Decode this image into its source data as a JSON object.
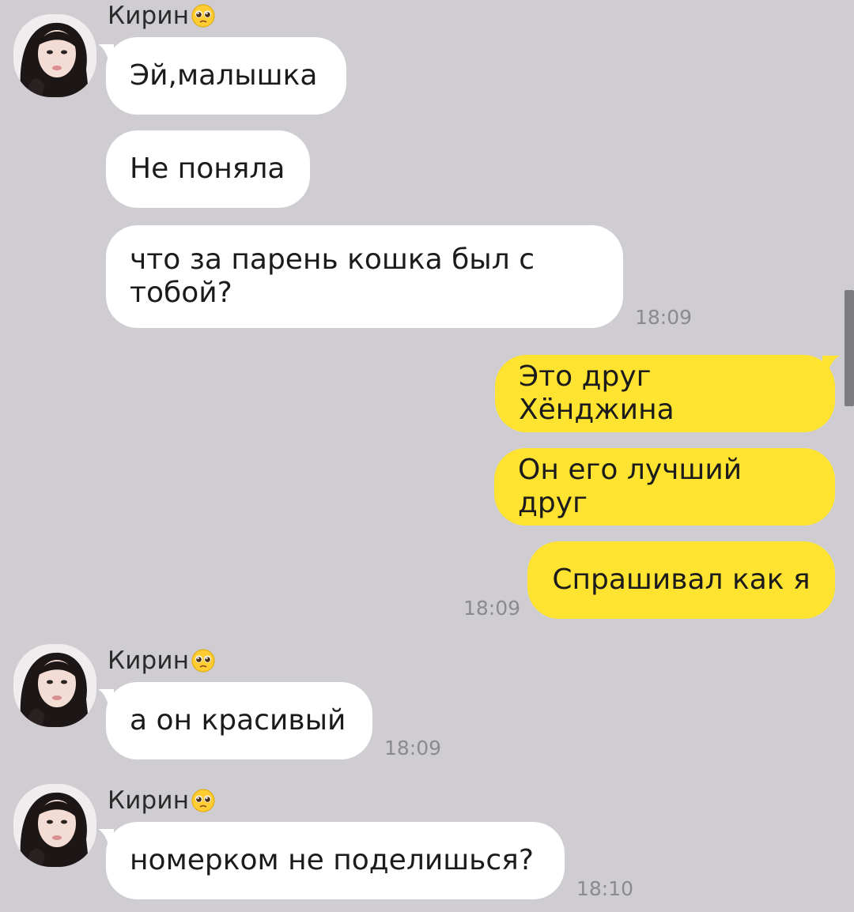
{
  "chat": {
    "contact_name": "Кирин",
    "contact_emoji": "pleading-face-emoji",
    "groups": [
      {
        "messages": [
          "Эй,малышка",
          "Не поняла",
          "что за парень кошка был с тобой?"
        ],
        "time": "18:09"
      },
      {
        "messages": [
          "Это друг Хёнджина",
          "Он его лучший друг",
          "Спрашивал как я"
        ],
        "time": "18:09"
      },
      {
        "messages": [
          "а он красивый"
        ],
        "time": "18:09"
      },
      {
        "messages": [
          "номерком не поделишься?"
        ],
        "time": "18:10"
      }
    ]
  },
  "colors": {
    "background": "#cfcdd1",
    "incoming_bubble": "#ffffff",
    "outgoing_bubble": "#fee330",
    "timestamp": "#8b8b8d"
  }
}
